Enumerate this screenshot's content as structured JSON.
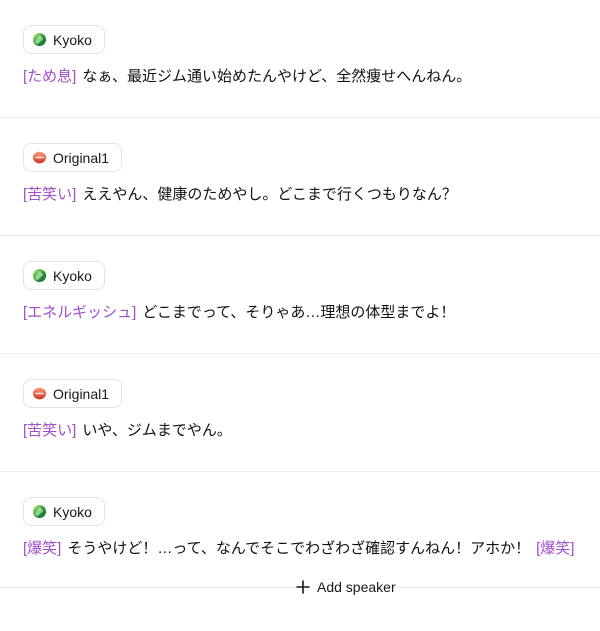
{
  "colors": {
    "tag": "#a24ec9",
    "text": "#111111",
    "chip_border": "#e4e4e7",
    "divider": "#eeeeee"
  },
  "dialogue": [
    {
      "speaker": "Kyoko",
      "avatar_icon": "green-gem-icon",
      "tag": "[ため息]",
      "text": "なぁ、最近ジム通い始めたんやけど、全然痩せへんねん。"
    },
    {
      "speaker": "Original1",
      "avatar_icon": "lips-icon",
      "tag": "[苦笑い]",
      "text": "ええやん、健康のためやし。どこまで行くつもりなん？"
    },
    {
      "speaker": "Kyoko",
      "avatar_icon": "green-gem-icon",
      "tag": "[エネルギッシュ]",
      "text": "どこまでって、そりゃあ…理想の体型までよ！"
    },
    {
      "speaker": "Original1",
      "avatar_icon": "lips-icon",
      "tag": "[苦笑い]",
      "text": "いや、ジムまでやん。"
    },
    {
      "speaker": "Kyoko",
      "avatar_icon": "green-gem-icon",
      "tag": "[爆笑]",
      "text": "そうやけど！…って、なんでそこでわざわざ確認すんねん！アホか！",
      "end_tag": "[爆笑]"
    }
  ],
  "add_speaker": {
    "label": "Add speaker",
    "icon": "plus-icon"
  }
}
